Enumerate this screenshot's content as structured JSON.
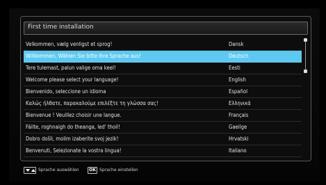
{
  "window": {
    "title": "First time installation"
  },
  "languages": [
    {
      "greeting": "Velkommen, vælg venligst et sprog!",
      "language": "Dansk",
      "selected": false
    },
    {
      "greeting": "Willkommen, Wählen Sie bitte Ihre Sprache aus!",
      "language": "Deutsch",
      "selected": true
    },
    {
      "greeting": "Tere tulemast, palun valige oma keel!",
      "language": "Eesti",
      "selected": false
    },
    {
      "greeting": "Welcome please select your language!",
      "language": "English",
      "selected": false
    },
    {
      "greeting": "Bienvenido, seleccione un idioma",
      "language": "Español",
      "selected": false
    },
    {
      "greeting": "Καλώς ήλθατε, παρακαλούμε επιλέξτε τη γλώσσα σας!",
      "language": "Ελληνικά",
      "selected": false
    },
    {
      "greeting": "Bienvenue ! Veuillez choisir une langue.",
      "language": "Français",
      "selected": false
    },
    {
      "greeting": "Fáilte, roghnaigh do theanga, led' thoil!",
      "language": "Gaeilge",
      "selected": false
    },
    {
      "greeting": "Dobro došli, molim izaberite svoj jezik!",
      "language": "Hrvatski",
      "selected": false
    },
    {
      "greeting": "Benvenuti, Selezionate la vostra lingua!",
      "language": "Italiano",
      "selected": false
    }
  ],
  "footer": {
    "select_hint": "Sprache auswählen",
    "ok_key_label": "OK",
    "set_hint": "Sprache einstellen"
  },
  "colors": {
    "selection_highlight": "#5ec9f0",
    "background": "#000000",
    "text": "#e6e6e6"
  }
}
